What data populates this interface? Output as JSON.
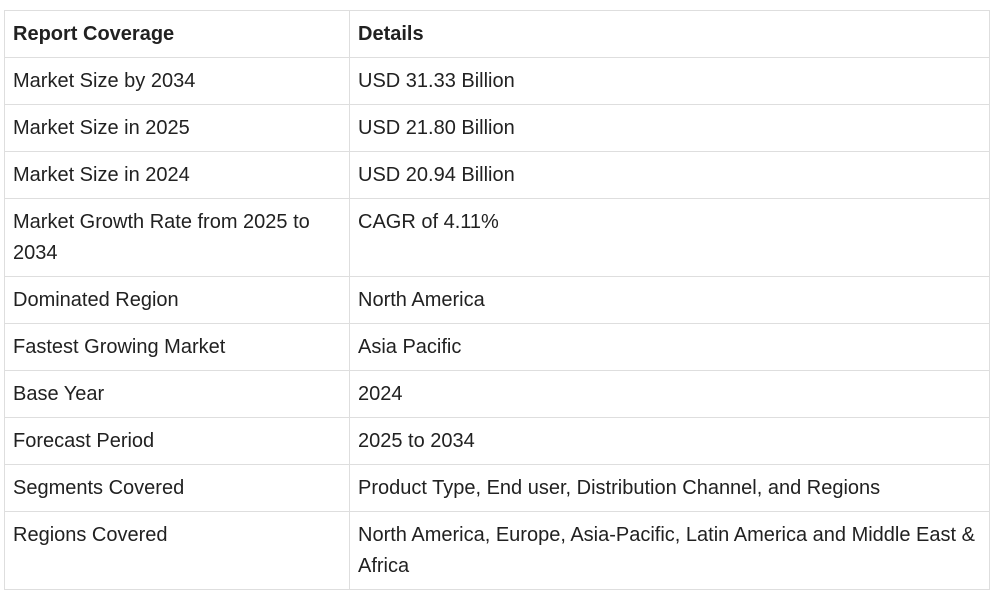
{
  "table": {
    "headers": [
      "Report Coverage",
      "Details"
    ],
    "rows": [
      [
        "Market Size by 2034",
        "USD 31.33 Billion"
      ],
      [
        "Market Size in 2025",
        "USD 21.80 Billion"
      ],
      [
        "Market Size in 2024",
        "USD 20.94 Billion"
      ],
      [
        "Market Growth Rate from 2025 to 2034",
        "CAGR of 4.11%"
      ],
      [
        "Dominated Region",
        "North America"
      ],
      [
        "Fastest Growing Market",
        "Asia Pacific"
      ],
      [
        "Base Year",
        "2024"
      ],
      [
        "Forecast Period",
        "2025 to 2034"
      ],
      [
        "Segments Covered",
        "Product Type, End user, Distribution Channel, and Regions"
      ],
      [
        "Regions Covered",
        "North America, Europe, Asia-Pacific, Latin America and Middle East & Africa"
      ]
    ]
  }
}
